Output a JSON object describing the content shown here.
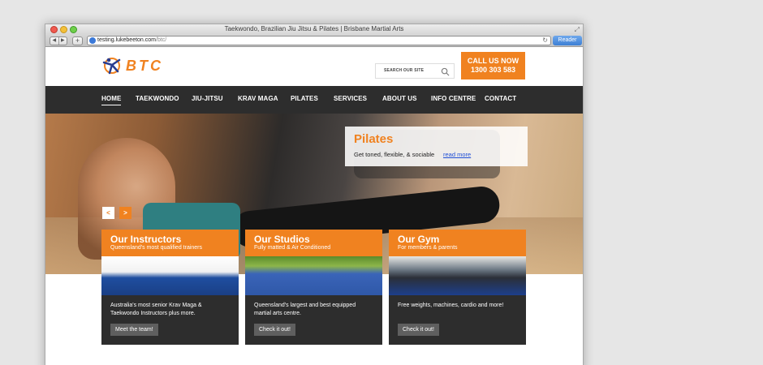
{
  "browser": {
    "window_title": "Taekwondo, Brazilian Jiu Jitsu & Pilates | Brisbane Martial Arts",
    "url_host": "testing.lukebeeton.com",
    "url_path": "/btc/",
    "nav_back": "◀",
    "nav_forward": "▶",
    "add_label": "+",
    "reload": "↻",
    "reader_label": "Reader"
  },
  "header": {
    "logo_text": "BTC",
    "search_placeholder": "SEARCH OUR SITE",
    "cta_line1": "CALL US NOW",
    "cta_line2": "1300 303 583",
    "accent_color": "#f08220"
  },
  "nav": {
    "items": [
      "HOME",
      "TAEKWONDO",
      "JIU-JITSU",
      "KRAV MAGA",
      "PILATES",
      "SERVICES",
      "ABOUT US",
      "INFO CENTRE",
      "CONTACT"
    ],
    "active": "HOME"
  },
  "hero": {
    "promo_title": "Pilates",
    "promo_text": "Get toned, flexible, & sociable",
    "promo_link": "read more",
    "prev_label": "<",
    "next_label": ">"
  },
  "cards": [
    {
      "title": "Our Instructors",
      "subtitle": "Queensland's most qualified trainers",
      "body": "Australia's most senior Krav Maga & Taekwondo Instructors plus more.",
      "button": "Meet the team!"
    },
    {
      "title": "Our Studios",
      "subtitle": "Fully matted & Air Conditioned",
      "body": "Queensland's largest and best equipped martial arts centre.",
      "button": "Check it out!"
    },
    {
      "title": "Our Gym",
      "subtitle": "For members & parents",
      "body": "Free weights, machines, cardio and more!",
      "button": "Check it out!"
    }
  ]
}
